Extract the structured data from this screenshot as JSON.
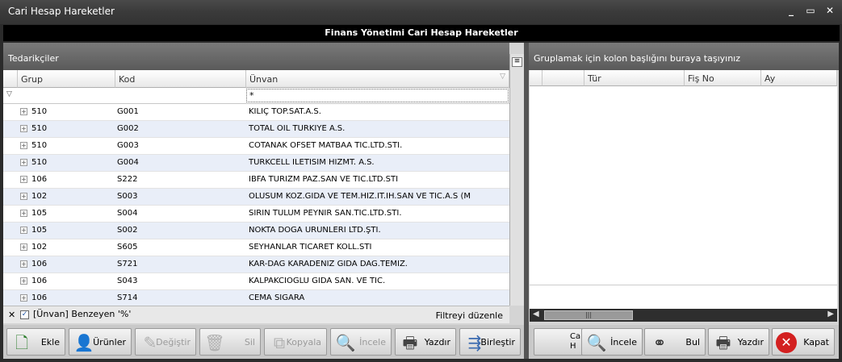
{
  "window": {
    "title": "Cari Hesap Hareketler",
    "minimize": "_",
    "maximize": "▭",
    "close": "✕"
  },
  "banner": "Finans Yönetimi Cari Hesap Hareketler",
  "left": {
    "panel_title": "Tedarikçiler",
    "columns": [
      "Grup",
      "Kod",
      "Ünvan"
    ],
    "filter_value": "*",
    "rows": [
      {
        "grup": "510",
        "kod": "G001",
        "unvan": "KILIÇ TOP.SAT.A.S."
      },
      {
        "grup": "510",
        "kod": "G002",
        "unvan": "TOTAL OIL TURKIYE A.S."
      },
      {
        "grup": "510",
        "kod": "G003",
        "unvan": "COTANAK OFSET MATBAA TIC.LTD.STI."
      },
      {
        "grup": "510",
        "kod": "G004",
        "unvan": "TURKCELL ILETISIM HIZMT. A.S."
      },
      {
        "grup": "106",
        "kod": "S222",
        "unvan": "IBFA TURIZM PAZ.SAN VE TIC.LTD.STI"
      },
      {
        "grup": "102",
        "kod": "S003",
        "unvan": "OLUSUM KOZ.GIDA VE TEM.HIZ.IT.IH.SAN VE TIC.A.S (M"
      },
      {
        "grup": "105",
        "kod": "S004",
        "unvan": "SIRIN TULUM PEYNIR SAN.TIC.LTD.STI."
      },
      {
        "grup": "105",
        "kod": "S002",
        "unvan": "NOKTA DOĞA ÜRÜNLERİ LTD.ŞTİ."
      },
      {
        "grup": "102",
        "kod": "S605",
        "unvan": "SEYHANLAR TICARET KOLL.STI"
      },
      {
        "grup": "106",
        "kod": "S721",
        "unvan": "KAR-DAG KARADENIZ GIDA DAG.TEMIZ."
      },
      {
        "grup": "106",
        "kod": "S043",
        "unvan": "KALPAKCIOGLU GIDA SAN. VE TIC."
      },
      {
        "grup": "106",
        "kod": "S714",
        "unvan": "CEMA SIGARA"
      }
    ],
    "filter_status": "[Ünvan] Benzeyen '%'",
    "filter_edit": "Filtreyi düzenle",
    "buttons": [
      {
        "label": "Ekle",
        "enabled": true,
        "icon": "add-document-icon"
      },
      {
        "label": "Ürünler",
        "enabled": true,
        "icon": "user-icon"
      },
      {
        "label": "Değiştir",
        "enabled": false,
        "icon": "edit-icon"
      },
      {
        "label": "Sil",
        "enabled": false,
        "icon": "delete-icon"
      },
      {
        "label": "Kopyala",
        "enabled": false,
        "icon": "copy-icon"
      },
      {
        "label": "İncele",
        "enabled": false,
        "icon": "inspect-icon"
      },
      {
        "label": "Yazdır",
        "enabled": true,
        "icon": "printer-icon"
      },
      {
        "label": "Birleştir",
        "enabled": true,
        "icon": "merge-icon"
      }
    ]
  },
  "right": {
    "group_hint": "Gruplamak için kolon başlığını buraya taşıyınız",
    "columns": [
      "Tür",
      "Fiş No",
      "Ay"
    ],
    "hidden_button_text": "Ca H",
    "buttons": [
      {
        "label": "İncele",
        "icon": "inspect-icon"
      },
      {
        "label": "Bul",
        "icon": "binoculars-icon"
      },
      {
        "label": "Yazdır",
        "icon": "printer-icon"
      },
      {
        "label": "Kapat",
        "icon": "close-circle-icon"
      }
    ]
  },
  "colors": {
    "alt_row": "#e9eef8",
    "banner": "#000000",
    "close_red": "#d32020"
  }
}
